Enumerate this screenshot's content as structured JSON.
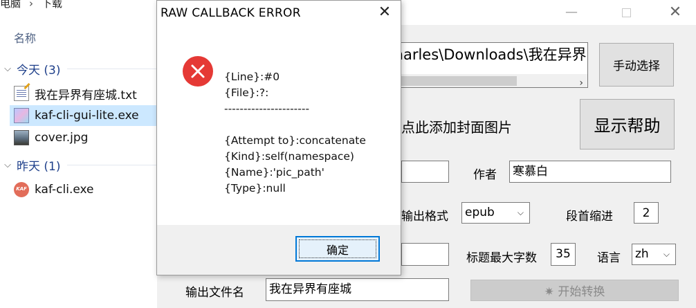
{
  "explorer": {
    "breadcrumb": [
      "电脑",
      "下载"
    ],
    "column_header": "名称",
    "groups": [
      {
        "label": "今天 (3)",
        "files": [
          {
            "name": "我在异界有座城.txt",
            "icon": "text-file-icon",
            "selected": false
          },
          {
            "name": "kaf-cli-gui-lite.exe",
            "icon": "exe-file-icon",
            "selected": true
          },
          {
            "name": "cover.jpg",
            "icon": "image-file-icon",
            "selected": false
          }
        ]
      },
      {
        "label": "昨天 (1)",
        "files": [
          {
            "name": "kaf-cli.exe",
            "icon": "kaf-cli-app-icon",
            "selected": false
          }
        ]
      }
    ]
  },
  "app": {
    "window_controls": {
      "minimize": "—",
      "close": "✕"
    },
    "path_value": "Charles\\Downloads\\我在异界",
    "manual_select_button": "手动选择",
    "cover_hint": "点此添加封面图片",
    "show_help_button": "显示帮助",
    "author_label": "作者",
    "author_value": "寒慕白",
    "output_format_label": "输出格式",
    "output_format_value": "epub",
    "indent_label": "段首缩进",
    "indent_value": "2",
    "title_max_label": "标题最大字数",
    "title_max_value": "35",
    "language_label": "语言",
    "language_value": "zh",
    "output_filename_label": "输出文件名",
    "output_filename_value": "我在异界有座城",
    "start_button": "✷ 开始转换"
  },
  "dialog": {
    "title": "RAW CALLBACK ERROR",
    "close_glyph": "✕",
    "icon": "error-icon",
    "message_lines": [
      "{Line}:#0",
      "{File}:?:",
      "----------------------",
      "",
      "{Attempt to}:concatenate",
      "{Kind}:self(namespace)",
      "{Name}:'pic_path'",
      "{Type}:null"
    ],
    "ok_button": "确定"
  },
  "colors": {
    "accent": "#0078d7",
    "error": "#e53935",
    "selection": "#cce8ff"
  }
}
